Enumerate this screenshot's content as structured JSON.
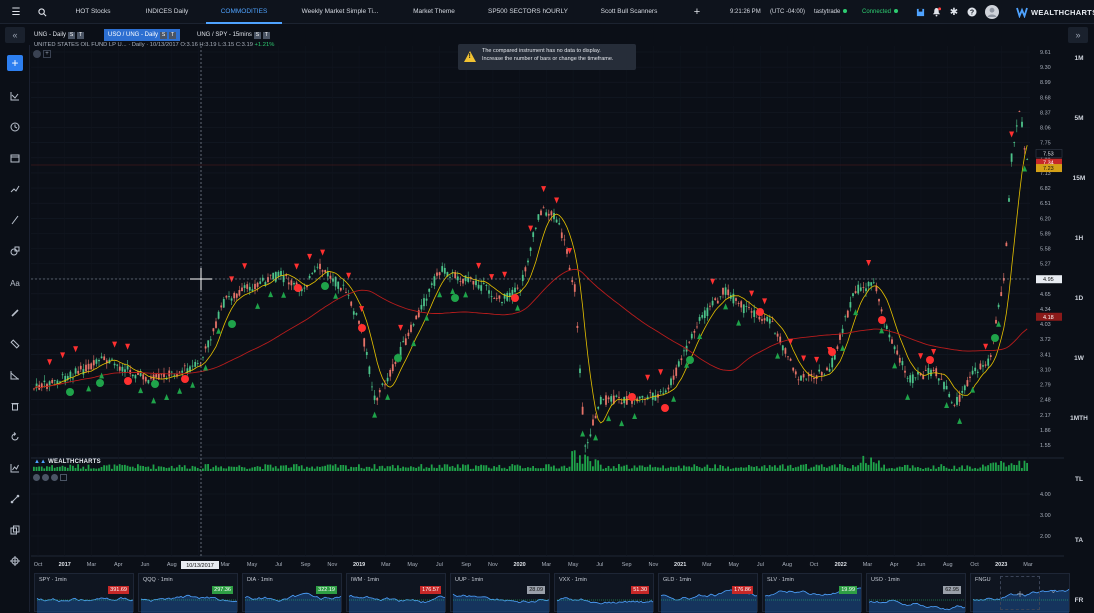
{
  "topbar": {
    "tabs": [
      "HOT Stocks",
      "INDICES Daily",
      "COMMODITIES",
      "Weekly Market Simple Ti...",
      "Market Theme",
      "SP500 SECTORS hOURLY",
      "Scott Bull Scanners"
    ],
    "active_tab": 2,
    "time": "9:21:26 PM",
    "timezone": "(UTC -04:00)",
    "broker": "tastytrade",
    "status": "Connected",
    "brand": "WEALTHCHARTS"
  },
  "chart_tabs": [
    {
      "label": "UNG - Daily",
      "b1": "S",
      "b2": "T"
    },
    {
      "label": "USO / UNG - Daily",
      "b1": "S",
      "b2": "T"
    },
    {
      "label": "UNG / SPY - 15mins",
      "b1": "S",
      "b2": "T"
    }
  ],
  "legend": {
    "title": "UNITED STATES OIL FUND LP U...",
    "interval": "· Daily · 10/13/2017",
    "ohlc": "O:3.16 H:3.19 L:3.15 C:3.19",
    "change": "+1.21%"
  },
  "toast": {
    "line1": "The compared instrument has no data to display.",
    "line2": "Increase the number of bars or change the timeframe."
  },
  "timeframes": [
    "1M",
    "5M",
    "15M",
    "1H",
    "1D",
    "1W",
    "1MTH",
    "TL",
    "TA",
    "FR"
  ],
  "price_axis": {
    "ticks": [
      "9.61",
      "9.30",
      "8.99",
      "8.68",
      "8.37",
      "8.06",
      "7.75",
      "7.44",
      "7.13",
      "6.82",
      "6.51",
      "6.20",
      "5.89",
      "5.58",
      "5.27",
      "4.96",
      "4.65",
      "4.34",
      "4.03",
      "3.72",
      "3.41",
      "3.10",
      "2.79",
      "2.48",
      "2.17",
      "1.86",
      "1.55"
    ],
    "markers": [
      {
        "value": "7.53",
        "color": "#0b0f17",
        "text_color": "#e0e4ea"
      },
      {
        "value": "7.34",
        "color": "#c62828",
        "text_color": "#ffffff"
      },
      {
        "value": "7.23",
        "color": "#d4a017",
        "text_color": "#111111"
      },
      {
        "value": "4.95",
        "color": "#e8ecf2",
        "text_color": "#111111"
      },
      {
        "value": "4.18",
        "color": "#8b1a1a",
        "text_color": "#ffffff"
      }
    ]
  },
  "osc_axis": [
    "4.00",
    "3.00",
    "2.00"
  ],
  "time_axis": {
    "labels": [
      "Oct",
      "2017",
      "Mar",
      "Apr",
      "Jun",
      "Aug",
      "2018",
      "Mar",
      "May",
      "Jul",
      "Sep",
      "Nov",
      "2019",
      "Mar",
      "May",
      "Jul",
      "Sep",
      "Nov",
      "2020",
      "Mar",
      "May",
      "Jul",
      "Sep",
      "Nov",
      "2021",
      "Mar",
      "May",
      "Jul",
      "Aug",
      "Oct",
      "2022",
      "Mar",
      "Apr",
      "Jun",
      "Aug",
      "Oct",
      "2023",
      "Mar"
    ],
    "cursor_date": "10/13/2017"
  },
  "brand_watermark": "WEALTHCHARTS",
  "mini_charts": [
    {
      "symbol": "SPY · 1min",
      "value": "391.69",
      "tone": "red"
    },
    {
      "symbol": "QQQ · 1min",
      "value": "297.36",
      "tone": "green"
    },
    {
      "symbol": "DIA · 1min",
      "value": "322.19",
      "tone": "green"
    },
    {
      "symbol": "IWM · 1min",
      "value": "176.57",
      "tone": "red"
    },
    {
      "symbol": "UUP · 1min",
      "value": "28.09",
      "tone": "grey"
    },
    {
      "symbol": "VXX · 1min",
      "value": "51.30",
      "tone": "red"
    },
    {
      "symbol": "GLD · 1min",
      "value": "176.86",
      "tone": "red"
    },
    {
      "symbol": "SLV · 1min",
      "value": "19.99",
      "tone": "green"
    },
    {
      "symbol": "USO · 1min",
      "value": "62.95",
      "tone": "grey"
    },
    {
      "symbol": "FNGU",
      "value": "",
      "tone": ""
    }
  ],
  "colors": {
    "up": "#2ecc71",
    "down": "#ff3b3b",
    "accent": "#2d7ff0",
    "ma_fast": "#e5c100",
    "ma_slow": "#b71c1c"
  }
}
